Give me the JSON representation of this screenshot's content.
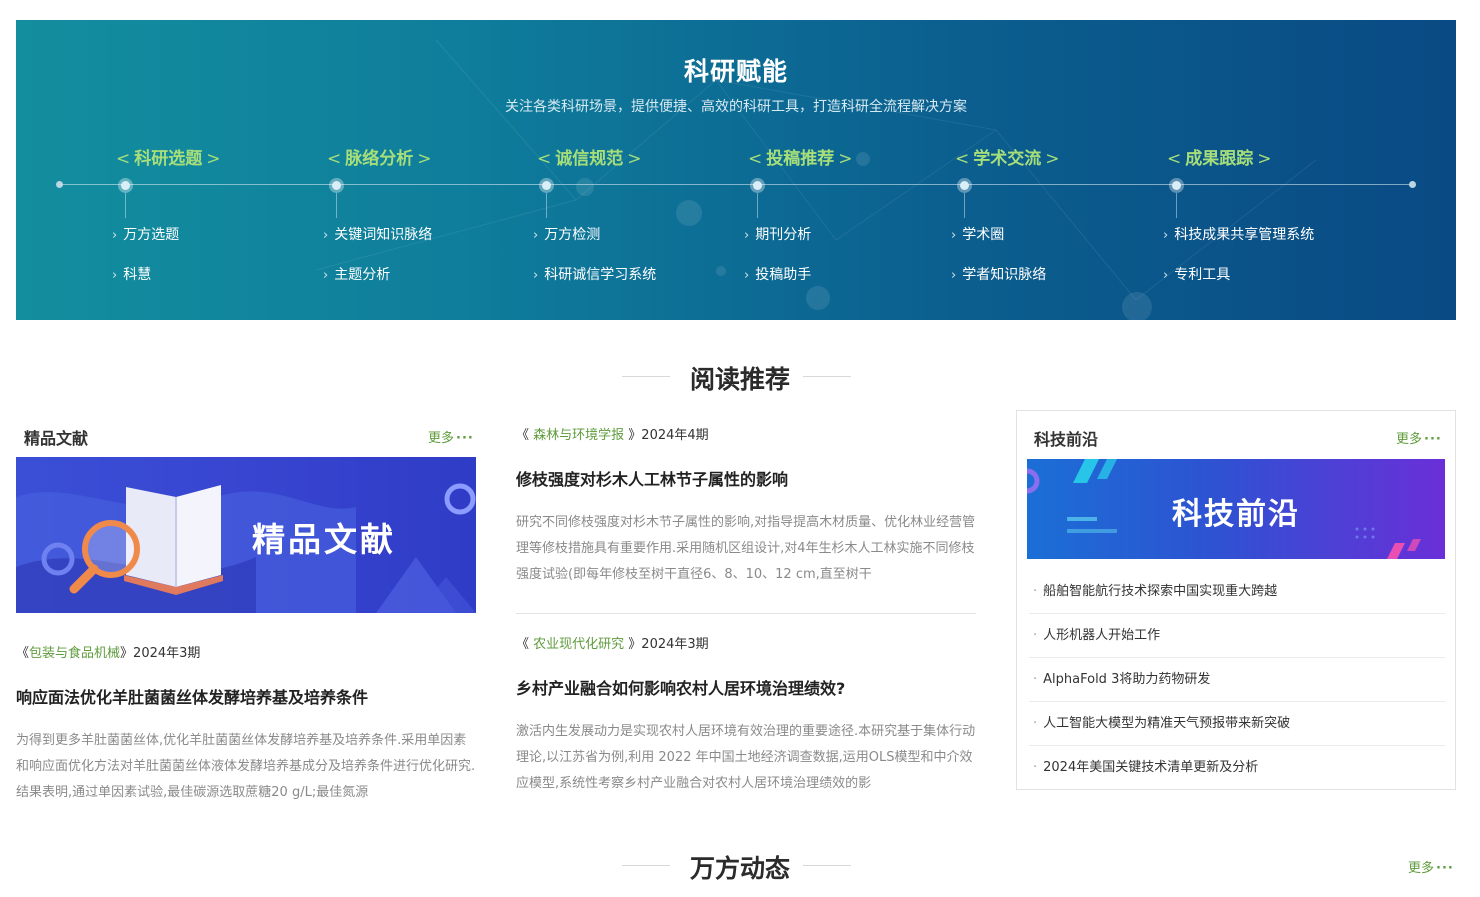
{
  "banner": {
    "title": "科研赋能",
    "subtitle": "关注各类科研场景，提供便捷、高效的科研工具，打造科研全流程解决方案",
    "columns": [
      {
        "heading": "科研选题",
        "links": [
          "万方选题",
          "科慧"
        ]
      },
      {
        "heading": "脉络分析",
        "links": [
          "关键词知识脉络",
          "主题分析"
        ]
      },
      {
        "heading": "诚信规范",
        "links": [
          "万方检测",
          "科研诚信学习系统"
        ]
      },
      {
        "heading": "投稿推荐",
        "links": [
          "期刊分析",
          "投稿助手"
        ]
      },
      {
        "heading": "学术交流",
        "links": [
          "学术圈",
          "学者知识脉络"
        ]
      },
      {
        "heading": "成果跟踪",
        "links": [
          "科技成果共享管理系统",
          "专利工具"
        ]
      }
    ]
  },
  "reading": {
    "title": "阅读推荐",
    "premium": {
      "heading": "精品文献",
      "more": "更多",
      "image_text": "精品文献",
      "article": {
        "journal": "包装与食品机械",
        "issue": "2024年3期",
        "title": "响应面法优化羊肚菌菌丝体发酵培养基及培养条件",
        "abstract": "为得到更多羊肚菌菌丝体,优化羊肚菌菌丝体发酵培养基及培养条件.采用单因素和响应面优化方法对羊肚菌菌丝体液体发酵培养基成分及培养条件进行优化研究.结果表明,通过单因素试验,最佳碳源选取蔗糖20 g/L;最佳氮源"
      }
    },
    "middle": [
      {
        "journal": "森林与环境学报",
        "issue": "2024年4期",
        "title": "修枝强度对杉木人工林节子属性的影响",
        "abstract": "研究不同修枝强度对杉木节子属性的影响,对指导提高木材质量、优化林业经营管理等修枝措施具有重要作用.采用随机区组设计,对4年生杉木人工林实施不同修枝强度试验(即每年修枝至树干直径6、8、10、12 cm,直至树干"
      },
      {
        "journal": "农业现代化研究",
        "issue": "2024年3期",
        "title": "乡村产业融合如何影响农村人居环境治理绩效?",
        "abstract": "激活内生发展动力是实现农村人居环境有效治理的重要途径.本研究基于集体行动理论,以江苏省为例,利用 2022 年中国土地经济调查数据,运用OLS模型和中介效应模型,系统性考察乡村产业融合对农村人居环境治理绩效的影"
      }
    ],
    "tech": {
      "heading": "科技前沿",
      "more": "更多",
      "image_text": "科技前沿",
      "items": [
        "船舶智能航行技术探索中国实现重大跨越",
        "人形机器人开始工作",
        "AlphaFold 3将助力药物研发",
        "人工智能大模型为精准天气预报带来新突破",
        "2024年美国关键技术清单更新及分析"
      ]
    }
  },
  "news": {
    "title": "万方动态",
    "more": "更多"
  },
  "colors": {
    "accent_green": "#5f9b3c",
    "banner_heading": "#a6de7a",
    "banner_start": "#138e9e",
    "banner_end": "#0a4a84"
  }
}
